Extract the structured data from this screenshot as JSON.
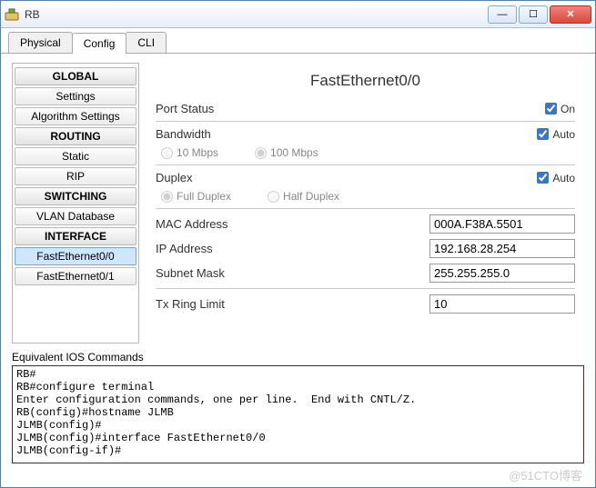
{
  "window": {
    "title": "RB"
  },
  "tabs": [
    "Physical",
    "Config",
    "CLI"
  ],
  "activeTab": 1,
  "sidebar": {
    "sections": [
      {
        "header": "GLOBAL",
        "items": [
          "Settings",
          "Algorithm Settings"
        ]
      },
      {
        "header": "ROUTING",
        "items": [
          "Static",
          "RIP"
        ]
      },
      {
        "header": "SWITCHING",
        "items": [
          "VLAN Database"
        ]
      },
      {
        "header": "INTERFACE",
        "items": [
          "FastEthernet0/0",
          "FastEthernet0/1"
        ]
      }
    ],
    "selected": "FastEthernet0/0"
  },
  "panel": {
    "title": "FastEthernet0/0",
    "portStatus": {
      "label": "Port Status",
      "toggleLabel": "On",
      "checked": true
    },
    "bandwidth": {
      "label": "Bandwidth",
      "autoLabel": "Auto",
      "auto": true,
      "options": [
        "10 Mbps",
        "100 Mbps"
      ],
      "selected": "100 Mbps"
    },
    "duplex": {
      "label": "Duplex",
      "autoLabel": "Auto",
      "auto": true,
      "options": [
        "Full Duplex",
        "Half Duplex"
      ],
      "selected": "Full Duplex"
    },
    "mac": {
      "label": "MAC Address",
      "value": "000A.F38A.5501"
    },
    "ip": {
      "label": "IP Address",
      "value": "192.168.28.254"
    },
    "mask": {
      "label": "Subnet Mask",
      "value": "255.255.255.0"
    },
    "txRing": {
      "label": "Tx Ring Limit",
      "value": "10"
    }
  },
  "ios": {
    "label": "Equivalent IOS Commands",
    "lines": [
      "RB#",
      "RB#configure terminal",
      "Enter configuration commands, one per line.  End with CNTL/Z.",
      "RB(config)#hostname JLMB",
      "JLMB(config)#",
      "JLMB(config)#interface FastEthernet0/0",
      "JLMB(config-if)#"
    ]
  },
  "watermark": "@51CTO博客"
}
